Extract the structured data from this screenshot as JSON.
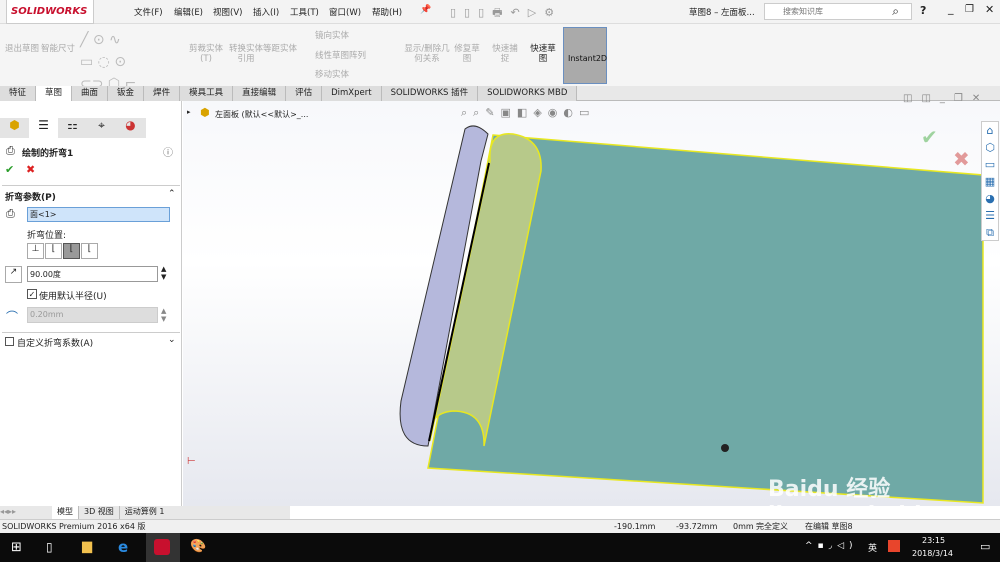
{
  "app": {
    "logo": "SOLIDWORKS",
    "doc_title": "草图8 – 左面板...",
    "search_placeholder": "搜索知识库"
  },
  "menu": [
    "文件(F)",
    "编辑(E)",
    "视图(V)",
    "插入(I)",
    "工具(T)",
    "窗口(W)",
    "帮助(H)"
  ],
  "ribbon": {
    "exit_sketch": "退出草图",
    "smart_dim": "智能尺寸",
    "trim": "剪裁实体(T)",
    "convert": "转换实体引用",
    "offset": "等距实体",
    "mirror": "镜向实体",
    "linear_pattern": "线性草图阵列",
    "move": "移动实体",
    "relations": "显示/删除几何关系",
    "repair": "修复草图",
    "quick_snap": "快速捕捉",
    "rapid_sketch": "快速草图",
    "instant2d": "Instant2D"
  },
  "tabs": [
    "特征",
    "草图",
    "曲面",
    "钣金",
    "焊件",
    "模具工具",
    "直接编辑",
    "评估",
    "DimXpert",
    "SOLIDWORKS 插件",
    "SOLIDWORKS MBD"
  ],
  "active_tab": "草图",
  "panel": {
    "title": "绘制的折弯1",
    "section": "折弯参数(P)",
    "face": "面<1>",
    "position_label": "折弯位置:",
    "angle": "90.00度",
    "use_default_radius": "使用默认半径(U)",
    "use_default_checked": true,
    "radius": "0.20mm",
    "custom": "自定义折弯系数(A)",
    "custom_checked": false
  },
  "tree": {
    "item": "左面板 (默认<<默认>_..."
  },
  "bottom_tabs": [
    "模型",
    "3D 视图",
    "运动算例 1"
  ],
  "status": {
    "product": "SOLIDWORKS Premium 2016 x64 版",
    "x": "-190.1mm",
    "y": "-93.72mm",
    "z": "0mm",
    "state": "完全定义",
    "mode": "在编辑 草图8"
  },
  "taskbar": {
    "time": "23:15",
    "date": "2018/3/14",
    "ime": "英"
  },
  "watermark": "Baidu 经验 jingyan.baidu.com",
  "colors": {
    "plate": "#6fa9a6",
    "cylinder": "#b7c98a",
    "curl": "#b5b8dc",
    "accent": "#c8102e"
  }
}
